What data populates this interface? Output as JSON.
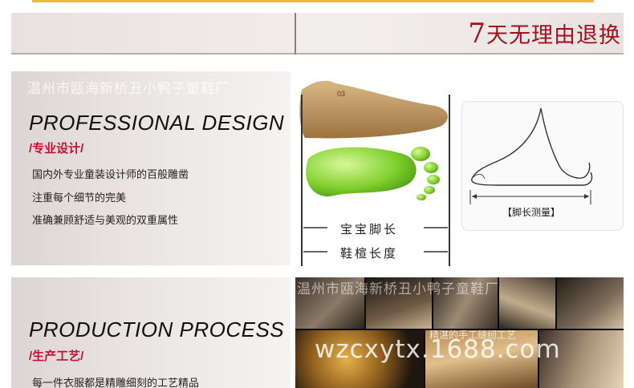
{
  "banner": {
    "text_number": "7",
    "text_rest": "天无理由退换"
  },
  "watermark": "温州市瓯海新桥丑小鸭子童鞋厂",
  "section_design": {
    "title_en": "PROFESSIONAL DESIGN",
    "title_cn": "/专业设计/",
    "lines": [
      "国内外专业童装设计师的百般雕凿",
      "注重每个细节的完美",
      "准确兼顾舒适与美观的双重属性"
    ]
  },
  "illustration": {
    "last_mark": "03",
    "foot_length_label": "宝宝脚长",
    "shoe_length_label": "鞋楦长度",
    "measure_label": "【脚长测量】"
  },
  "section_production": {
    "title_en": "PRODUCTION PROCESS",
    "title_cn": "/生产工艺/",
    "lines": [
      "每一件衣服都是精雕细刻的工艺精品"
    ]
  },
  "collage": {
    "watermark": "温州市瓯海新桥丑小鸭子童鞋厂",
    "site_watermark": "wzcxytx.1688.com",
    "craft_tag": "精湛的手工缝纫工艺"
  },
  "colors": {
    "accent_red": "#c8102e",
    "banner_red": "#a3121c",
    "top_line": "#e8b84a"
  }
}
